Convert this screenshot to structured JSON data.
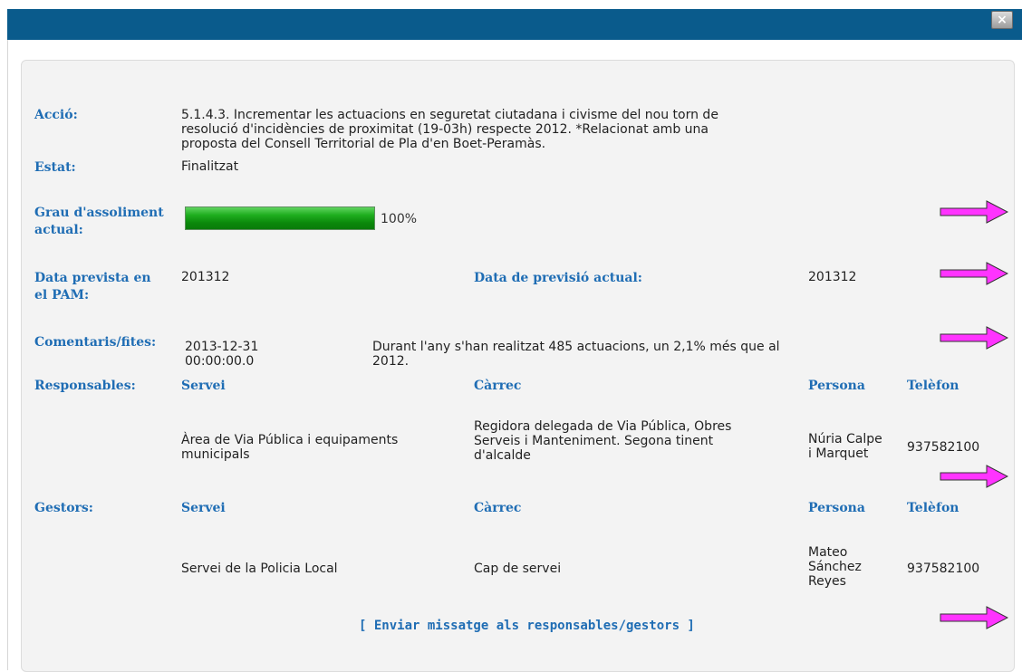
{
  "window": {
    "close_glyph": "×"
  },
  "action": {
    "label": "Acció:",
    "lines": [
      "5.1.4.3. Incrementar les actuacions en seguretat ciutadana i civisme del nou torn de",
      "resolució d'incidències de proximitat (19-03h) respecte 2012. *Relacionat amb una",
      "proposta del Consell Territorial de Pla d'en Boet-Peramàs."
    ]
  },
  "status": {
    "label": "Estat:",
    "value": "Finalitzat"
  },
  "achievement": {
    "label_line1": "Grau d'assoliment",
    "label_line2": "actual:",
    "percent_text": "100%",
    "fraction": 1.0
  },
  "dates": {
    "planned_label_line1": "Data prevista en",
    "planned_label_line2": "el PAM:",
    "planned_value": "201312",
    "current_label": "Data de previsió actual:",
    "current_value": "201312"
  },
  "comments": {
    "label": "Comentaris/fites:",
    "date_line1": "2013-12-31",
    "date_line2": "00:00:00.0",
    "text_line1": "Durant l'any s'han realitzat 485 actuacions, un 2,1% més que al",
    "text_line2": "2012."
  },
  "responsables": {
    "label": "Responsables:",
    "headers": {
      "service": "Servei",
      "role": "Càrrec",
      "person": "Persona",
      "phone": "Telèfon"
    },
    "row": {
      "service_line1": "Àrea de Via Pública i equipaments",
      "service_line2": "municipals",
      "role_line1": "Regidora delegada de Via Pública, Obres",
      "role_line2": "Serveis i Manteniment. Segona tinent",
      "role_line3": "d'alcalde",
      "person_line1": "Núria Calpe",
      "person_line2": "i Marquet",
      "phone": "937582100"
    }
  },
  "gestors": {
    "label": "Gestors:",
    "headers": {
      "service": "Servei",
      "role": "Càrrec",
      "person": "Persona",
      "phone": "Telèfon"
    },
    "row": {
      "service": "Servei de la Policia Local",
      "role": "Cap de servei",
      "person_line1": "Mateo",
      "person_line2": "Sánchez",
      "person_line3": "Reyes",
      "phone": "937582100"
    }
  },
  "send_link": "[ Enviar missatge als responsables/gestors ]",
  "colors": {
    "titlebar": "#0a5b8c",
    "label_blue": "#1f6db4",
    "arrow_fill": "#ff33ff",
    "progress_green": "#1fae1f"
  }
}
